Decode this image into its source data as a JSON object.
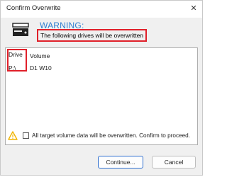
{
  "window": {
    "title": "Confirm Overwrite",
    "close_symbol": "✕"
  },
  "header": {
    "warning_title": "WARNING:",
    "warning_message": "The following drives will be overwritten"
  },
  "list": {
    "columns": [
      "Drive",
      "Volume"
    ],
    "rows": [
      {
        "drive": "P:\\",
        "volume": "D1 W10"
      }
    ]
  },
  "confirm": {
    "checked": false,
    "label": "All target volume data will be overwritten. Confirm to proceed."
  },
  "buttons": {
    "continue": "Continue...",
    "cancel": "Cancel"
  },
  "colors": {
    "highlight": "#e0202a",
    "accent": "#2f7fd0",
    "warning_yellow": "#f0b400"
  }
}
